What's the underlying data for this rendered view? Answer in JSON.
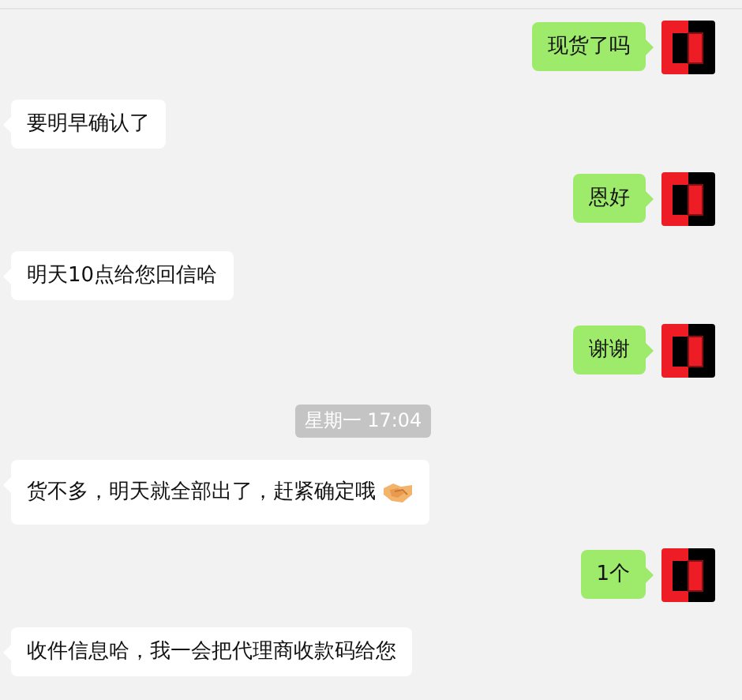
{
  "messages": [
    {
      "kind": "sent",
      "text": "现货了吗",
      "trailing_icon": false
    },
    {
      "kind": "received",
      "text": "要明早确认了",
      "trailing_icon": false
    },
    {
      "kind": "sent",
      "text": "恩好",
      "trailing_icon": false
    },
    {
      "kind": "received",
      "text": "明天10点给您回信哈",
      "trailing_icon": false
    },
    {
      "kind": "sent",
      "text": "谢谢",
      "trailing_icon": false
    },
    {
      "kind": "timestamp",
      "text": "星期一 17:04"
    },
    {
      "kind": "received",
      "text": "货不多，明天就全部出了，赶紧确定哦",
      "trailing_icon": true
    },
    {
      "kind": "sent",
      "text": "1个",
      "trailing_icon": false
    },
    {
      "kind": "received",
      "text": "收件信息哈，我一会把代理商收款码给您",
      "trailing_icon": false
    }
  ]
}
